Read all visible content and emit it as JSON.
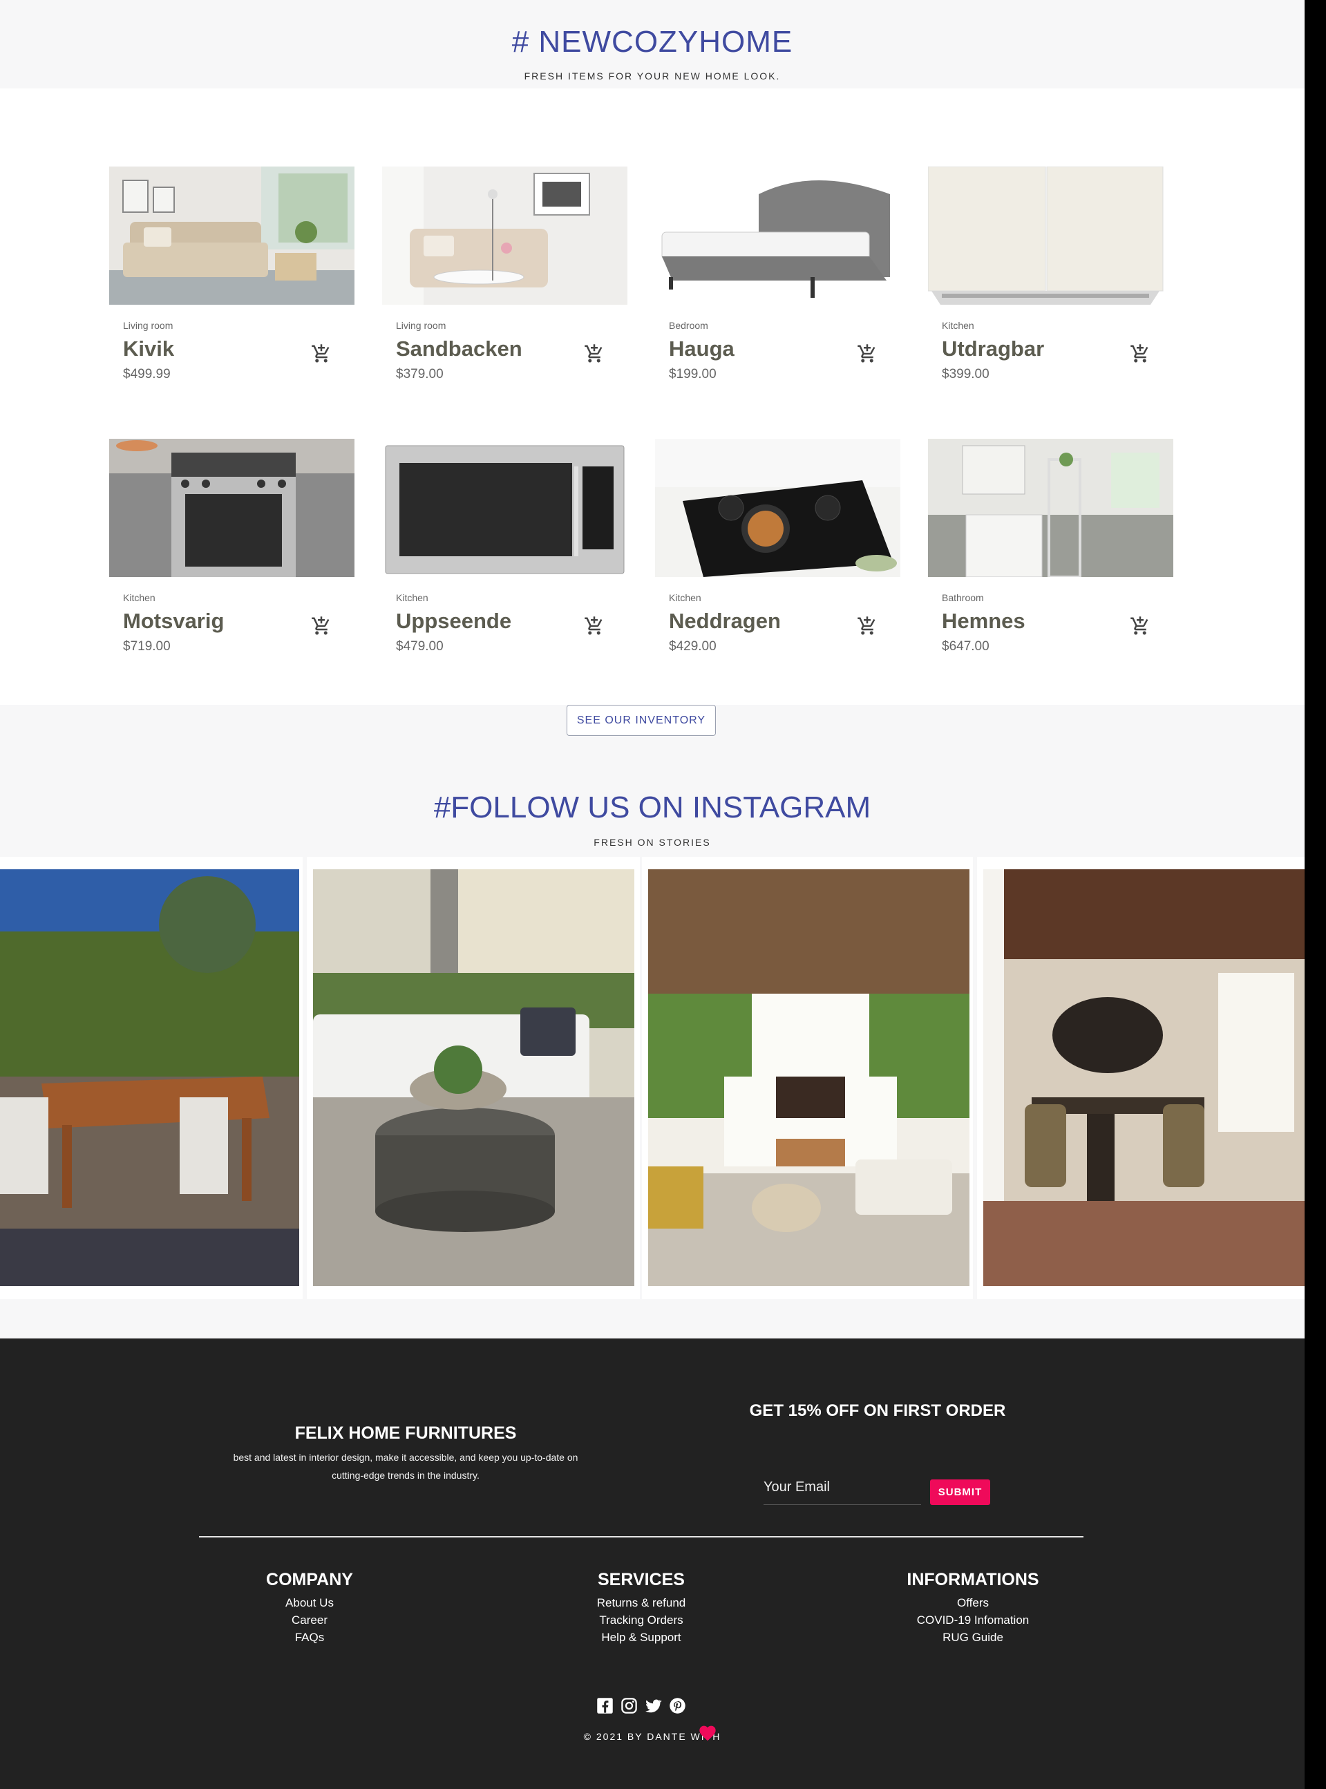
{
  "hero": {
    "title": "# NEWCOZYHOME",
    "subtitle": "FRESH ITEMS FOR YOUR NEW HOME LOOK."
  },
  "products": [
    {
      "category": "Living room",
      "name": "Kivik",
      "price": "$499.99",
      "image": "sofa-living-room"
    },
    {
      "category": "Living room",
      "name": "Sandbacken",
      "price": "$379.00",
      "image": "loveseat-living-room"
    },
    {
      "category": "Bedroom",
      "name": "Hauga",
      "price": "$199.00",
      "image": "grey-bed"
    },
    {
      "category": "Kitchen",
      "name": "Utdragbar",
      "price": "$399.00",
      "image": "range-hood-cabinet"
    },
    {
      "category": "Kitchen",
      "name": "Motsvarig",
      "price": "$719.00",
      "image": "gas-range-oven"
    },
    {
      "category": "Kitchen",
      "name": "Uppseende",
      "price": "$479.00",
      "image": "microwave"
    },
    {
      "category": "Kitchen",
      "name": "Neddragen",
      "price": "$429.00",
      "image": "cooktop"
    },
    {
      "category": "Bathroom",
      "name": "Hemnes",
      "price": "$647.00",
      "image": "bathroom-vanity"
    }
  ],
  "cart_icon": "add-shopping-cart-icon",
  "inventory_button": "SEE OUR INVENTORY",
  "instagram": {
    "title": "#FOLLOW US ON INSTAGRAM",
    "subtitle": "FRESH ON STORIES",
    "images": [
      "outdoor-dining-table",
      "outdoor-coffee-table",
      "outdoor-fireplace",
      "rustic-dining-room"
    ]
  },
  "footer": {
    "brand": "FELIX HOME FURNITURES",
    "description": "best and latest in interior design, make it accessible, and keep you up-to-date on cutting-edge trends in the industry.",
    "promo": "GET 15% OFF ON FIRST ORDER",
    "email_placeholder": "Your Email",
    "submit": "SUBMIT",
    "columns": [
      {
        "title": "COMPANY",
        "links": [
          "About Us",
          "Career",
          "FAQs"
        ]
      },
      {
        "title": "SERVICES",
        "links": [
          "Returns & refund",
          "Tracking Orders",
          "Help & Support"
        ]
      },
      {
        "title": "INFORMATIONS",
        "links": [
          "Offers",
          "COVID-19 Infomation",
          "RUG Guide"
        ]
      }
    ],
    "socials": [
      "facebook-icon",
      "instagram-icon",
      "twitter-icon",
      "pinterest-icon"
    ],
    "copyright": "© 2021 BY DANTE WITH",
    "accent": "#ef0a5a"
  },
  "colors": {
    "heading": "#3f4aa0",
    "footer_bg": "#222222",
    "product_name": "#5c5c50"
  }
}
